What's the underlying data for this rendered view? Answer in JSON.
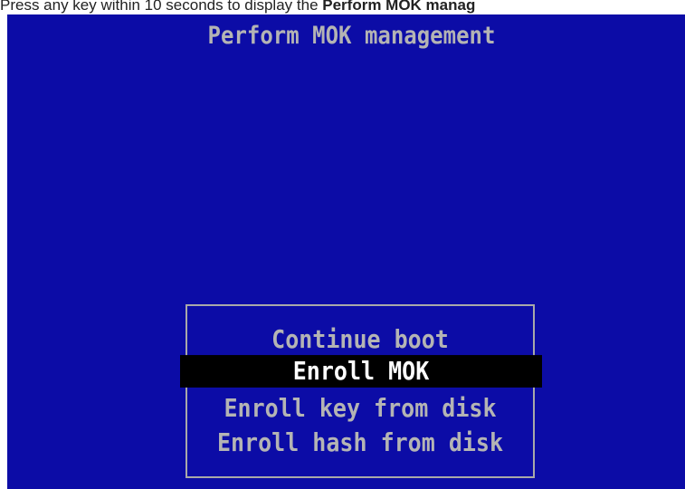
{
  "caption": {
    "prefix": "Press any key within 10 seconds to display the ",
    "bold": "Perform MOK manag"
  },
  "screen": {
    "title": "Perform MOK management",
    "menu": {
      "items": [
        {
          "label": "Continue boot"
        },
        {
          "label": "Enroll MOK"
        },
        {
          "label": "Enroll key from disk"
        },
        {
          "label": "Enroll hash from disk"
        }
      ],
      "selected_index": 1
    },
    "colors": {
      "background": "#0c0ca6",
      "text": "#b4b4b4",
      "selected_bg": "#000000",
      "selected_text": "#ffffff",
      "border": "#a9a9a9"
    }
  }
}
